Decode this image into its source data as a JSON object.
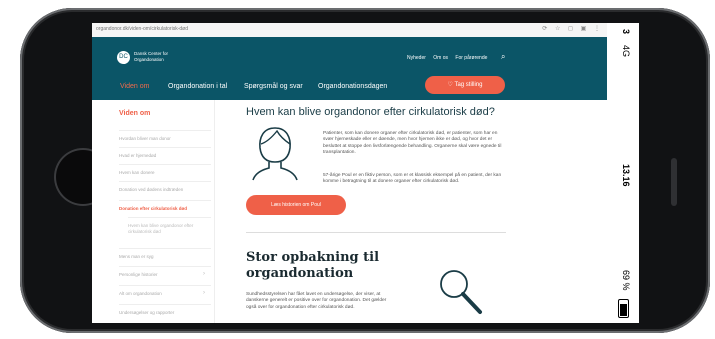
{
  "status_bar": {
    "signal": "3",
    "network": "4G",
    "time": "13.16",
    "battery": "69 %"
  },
  "browser": {
    "url": "organdonor.dk/viden-om/cirkulatorisk-død"
  },
  "header": {
    "logo_initials": "DC",
    "logo_name": "Dansk Center for Organdonation",
    "top_links": [
      "Nyheder",
      "Om os",
      "For pårørende"
    ],
    "nav": [
      "Viden om",
      "Organdonation i tal",
      "Spørgsmål og svar",
      "Organdonationsdagen"
    ],
    "cta": "Tag stilling"
  },
  "sidebar": {
    "title": "Viden om",
    "items": [
      {
        "label": "Hvordan bliver man donor",
        "chevron": false
      },
      {
        "label": "Hvad er hjernedød",
        "chevron": false
      },
      {
        "label": "Hvem kan donere",
        "chevron": false
      },
      {
        "label": "Donation ved dødens indtræden",
        "chevron": false
      },
      {
        "label": "Donation efter cirkulatorisk død",
        "chevron": false,
        "active": true
      },
      {
        "label": "Hvem kan blive organdonor efter cirkulatorisk død",
        "chevron": false,
        "sub": true
      },
      {
        "label": "Mens man er syg",
        "chevron": false
      },
      {
        "label": "Personlige historier",
        "chevron": true
      },
      {
        "label": "Alt om organdonation",
        "chevron": true
      },
      {
        "label": "Undersøgelser og rapporter",
        "chevron": false
      }
    ]
  },
  "main": {
    "heading": "Hvem kan blive organdonor efter cirkulatorisk død?",
    "para1": "Patienter, som kan donere organer efter cirkulatorisk død, er patienter, som har en svær hjerneskade eller er døende, men hvor hjernen ikke er død, og hvor det er besluttet at stoppe den livsforlængende behandling. Organerne skal være egnede til transplantation.",
    "para2": "57-årige Poul er en fiktiv person, som er et klassisk eksempel på en patient, der kan komme i betragtning til at donere organer efter cirkulatorisk død.",
    "story_button": "Læs historien om Poul",
    "heading2": "Stor opbakning til organdonation",
    "para3": "Sundhedsstyrelsen har fået lavet en undersøgelse, der viser, at danskerne generelt er positive over for organdonation. Det gælder også over for organdonation efter cirkulatorisk død."
  },
  "icons": {
    "person": "person-outline-icon",
    "magnifier": "magnifier-icon",
    "heart": "heart-icon",
    "search": "search-icon"
  },
  "colors": {
    "brand": "#0b5567",
    "accent": "#ef6048"
  }
}
